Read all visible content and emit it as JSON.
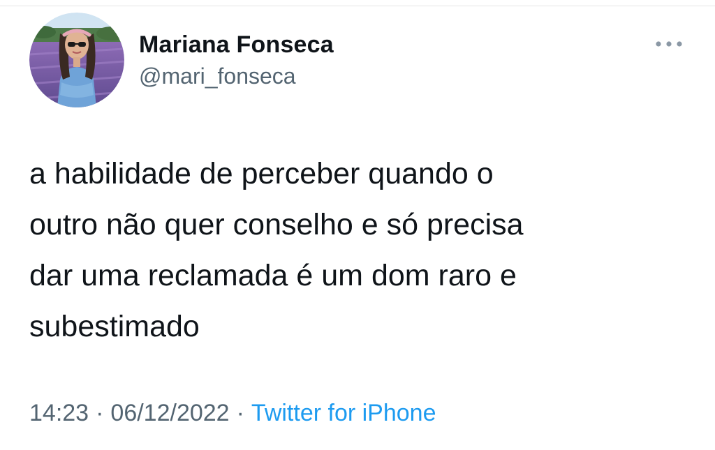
{
  "tweet": {
    "author": {
      "display_name": "Mariana Fonseca",
      "handle": "@mari_fonseca",
      "avatar_icon": "profile-photo-avatar"
    },
    "more_icon": "more-options-icon",
    "text": "a habilidade de perceber quando o\noutro não quer conselho e só precisa\ndar uma reclamada é um dom raro e\nsubestimado",
    "meta": {
      "time": "14:23",
      "separator": "·",
      "date": "06/12/2022",
      "source": "Twitter for iPhone"
    }
  },
  "colors": {
    "text_primary": "#0f1419",
    "text_secondary": "#536471",
    "link_blue": "#1d9bf0",
    "background": "#ffffff"
  }
}
